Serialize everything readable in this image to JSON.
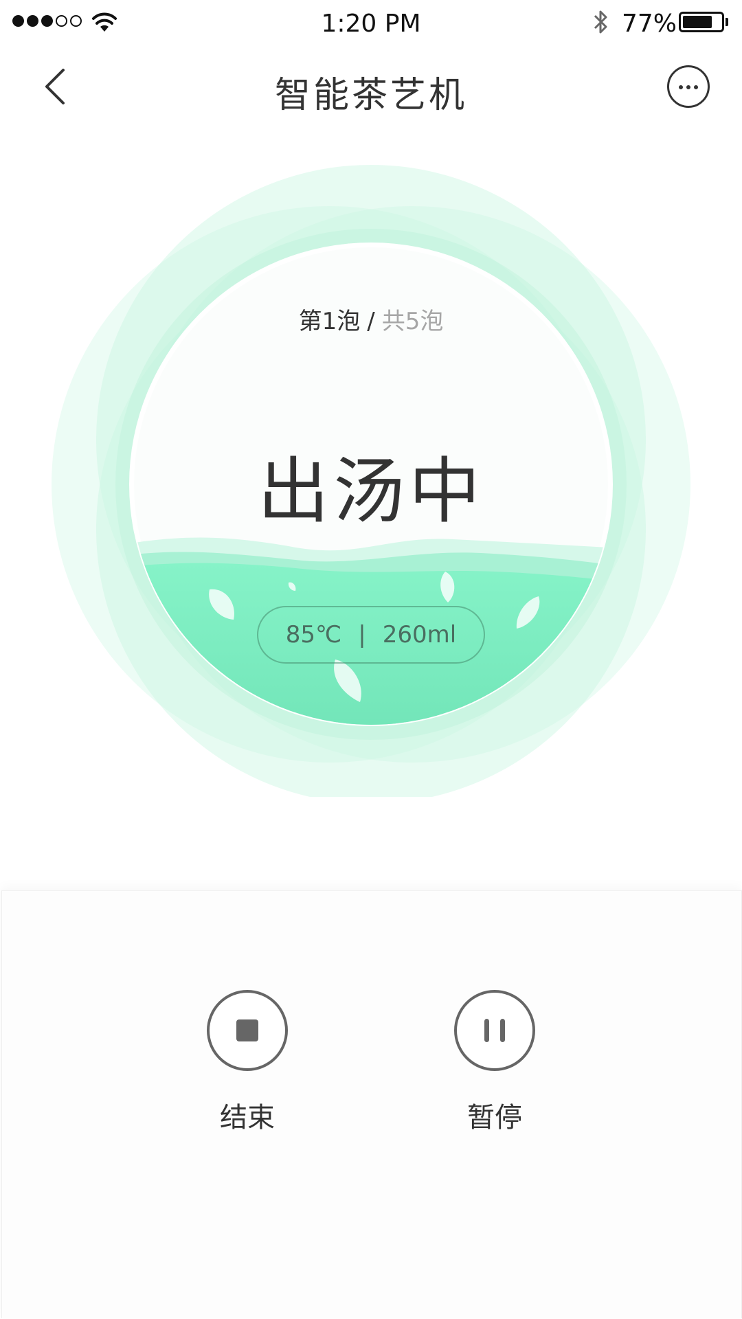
{
  "status_bar": {
    "signal_bars_filled": 3,
    "signal_bars_total": 5,
    "time": "1:20 PM",
    "battery_percent_label": "77%",
    "battery_level": 0.77
  },
  "nav": {
    "title": "智能茶艺机",
    "back_icon": "chevron-left-icon",
    "more_icon": "more-dots-icon"
  },
  "brew": {
    "current": "第1泡",
    "separator": "/",
    "total": "共5泡",
    "status": "出汤中",
    "temperature": "85℃",
    "spec_separator": "|",
    "volume": "260ml"
  },
  "controls": {
    "stop_label": "结束",
    "pause_label": "暂停",
    "stop_icon": "stop-icon",
    "pause_icon": "pause-icon"
  },
  "colors": {
    "accent_green": "#7ff0c2",
    "ring_green": "#c8f7e4",
    "text_dark": "#333333",
    "text_muted": "#a6a6a6"
  }
}
